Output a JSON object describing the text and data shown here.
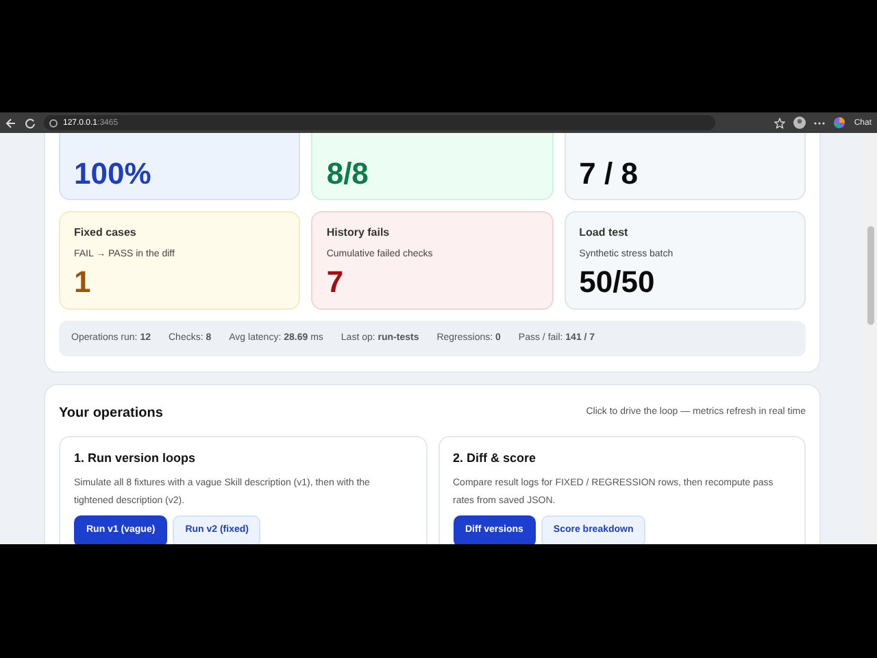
{
  "browser": {
    "url_host": "127.0.0.1",
    "url_port": ":3465",
    "chat_label": "Chat"
  },
  "top_metrics": [
    {
      "value": "100%",
      "color": "#1d3fbf"
    },
    {
      "value": "8/8",
      "color": "#0f7a4a"
    },
    {
      "value": "7 / 8",
      "color": "#0b0b0b"
    }
  ],
  "metrics": [
    {
      "title": "Fixed cases",
      "subtitle": "FAIL → PASS in the diff",
      "value": "1",
      "color": "#a0520a"
    },
    {
      "title": "History fails",
      "subtitle": "Cumulative failed checks",
      "value": "7",
      "color": "#a30d12"
    },
    {
      "title": "Load test",
      "subtitle": "Synthetic stress batch",
      "value": "50/50",
      "color": "#0b0b0b"
    }
  ],
  "stats": [
    "Operations run: **12**",
    "Checks: **8**",
    "Avg latency: **28.69** ms",
    "Last op: **run-tests**",
    "Regressions: **0**",
    "Pass / fail: **141 / 7**"
  ],
  "operations": {
    "title": "Your operations",
    "hint": "Click to drive the loop — metrics refresh in real time",
    "cards": [
      {
        "title": "1. Run version loops",
        "description": "Simulate all 8 fixtures with a vague Skill description (v1), then with the tightened description (v2).",
        "buttons": [
          {
            "label": "Run v1 (vague)",
            "primary": true
          },
          {
            "label": "Run v2 (fixed)",
            "primary": false
          }
        ]
      },
      {
        "title": "2. Diff & score",
        "description": "Compare result logs for FIXED / REGRESSION rows, then recompute pass rates from saved JSON.",
        "buttons": [
          {
            "label": "Diff versions",
            "primary": true
          },
          {
            "label": "Score breakdown",
            "primary": false
          }
        ]
      }
    ]
  }
}
